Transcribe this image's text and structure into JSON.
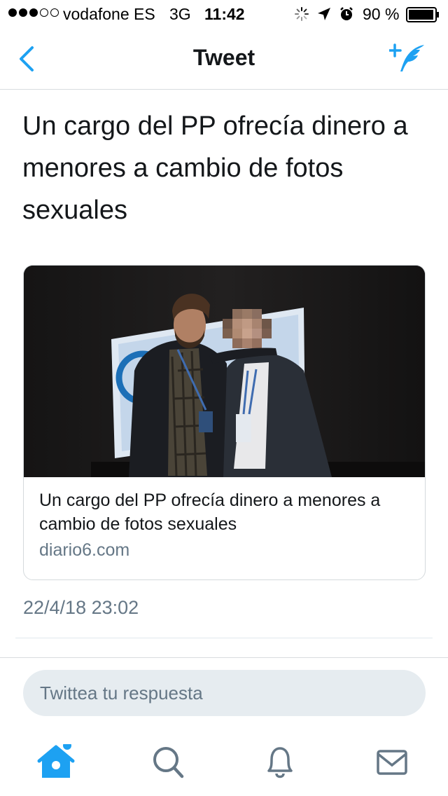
{
  "status_bar": {
    "carrier": "vodafone ES",
    "network": "3G",
    "time": "11:42",
    "battery": "90 %",
    "icons": [
      "signal-dots",
      "activity-spinner-icon",
      "location-arrow-icon",
      "alarm-clock-icon",
      "battery-icon"
    ]
  },
  "nav": {
    "title": "Tweet",
    "back_icon": "chevron-left-icon",
    "compose_icon": "compose-feather-icon"
  },
  "tweet": {
    "text": "Un cargo del PP ofrecía dinero a menores a cambio de fotos sexuales",
    "timestamp": "22/4/18 23:02"
  },
  "card": {
    "title": "Un cargo del PP ofrecía dinero a menores a cambio de fotos sexuales",
    "domain": "diario6.com",
    "image": "photo-two-men-at-pp-event"
  },
  "reply": {
    "placeholder": "Twittea tu respuesta"
  },
  "tab_bar": {
    "items": [
      "home-icon",
      "search-icon",
      "notifications-bell-icon",
      "messages-envelope-icon"
    ],
    "active": "home-icon"
  },
  "colors": {
    "accent": "#1da1f2",
    "secondary_text": "#657786",
    "primary_text": "#14171a",
    "input_bg": "#e6ecf0"
  }
}
